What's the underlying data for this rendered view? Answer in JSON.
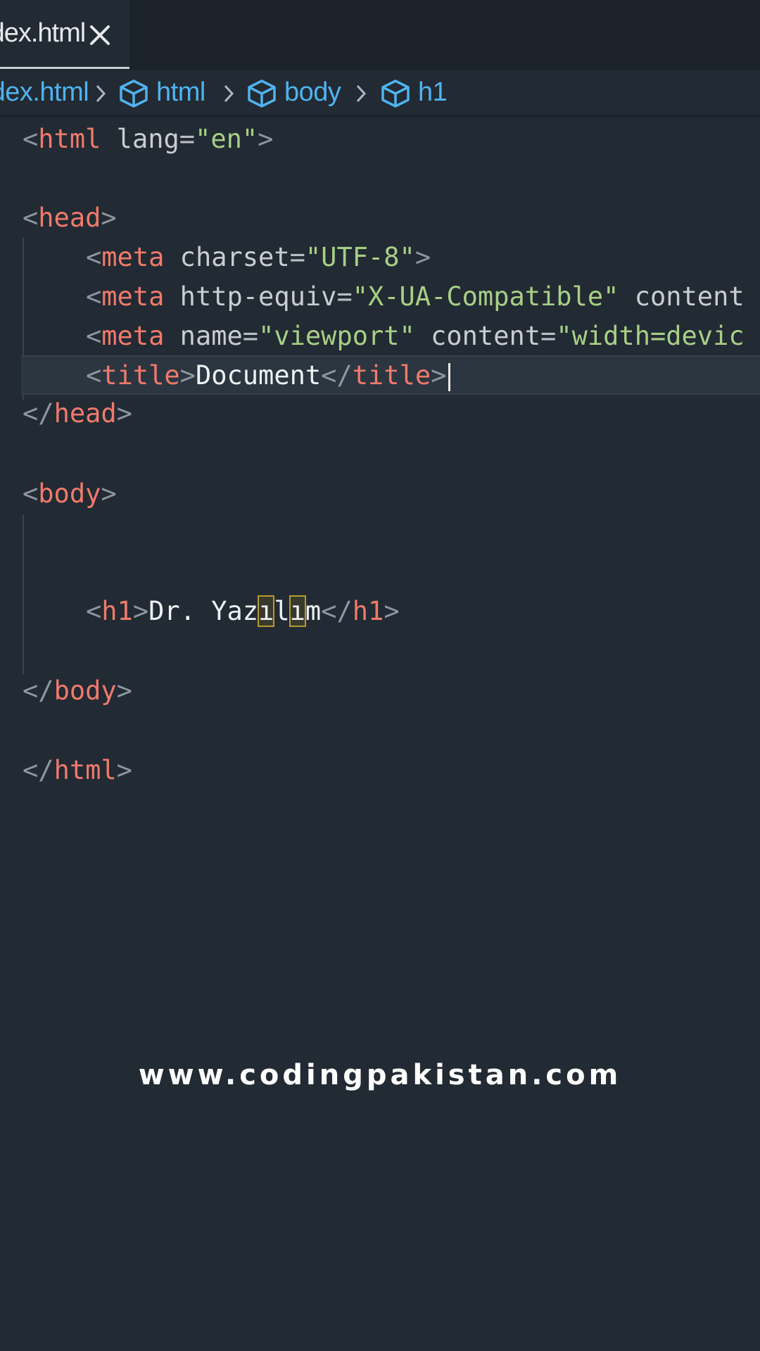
{
  "tab": {
    "label": "index.html",
    "close_glyph": "×"
  },
  "breadcrumb": {
    "file": "index.html",
    "items": [
      "html",
      "body",
      "h1"
    ]
  },
  "code": {
    "html_open": {
      "tag": "html",
      "attr": "lang",
      "value": "\"en\""
    },
    "head_open": "head",
    "meta1": {
      "tag": "meta",
      "attr": "charset",
      "value": "\"UTF-8\""
    },
    "meta2": {
      "tag": "meta",
      "attr": "http-equiv",
      "value": "\"X-UA-Compatible\"",
      "attr2": "content"
    },
    "meta3": {
      "tag": "meta",
      "attr": "name",
      "value": "\"viewport\"",
      "attr2": "content",
      "value2": "\"width=devic"
    },
    "title": {
      "tag": "title",
      "text": "Document"
    },
    "head_close": "head",
    "body_open": "body",
    "h1": {
      "tag": "h1",
      "text_a": "Dr. Yaz",
      "text_b": "ı",
      "text_c": "l",
      "text_d": "ı",
      "text_e": "m"
    },
    "body_close": "body",
    "html_close": "html"
  },
  "watermark": "www.codingpakistan.com",
  "colors": {
    "background": "#222a33",
    "tag": "#f07a6c",
    "string": "#a7cf86",
    "breadcrumb": "#4fb3ee"
  }
}
